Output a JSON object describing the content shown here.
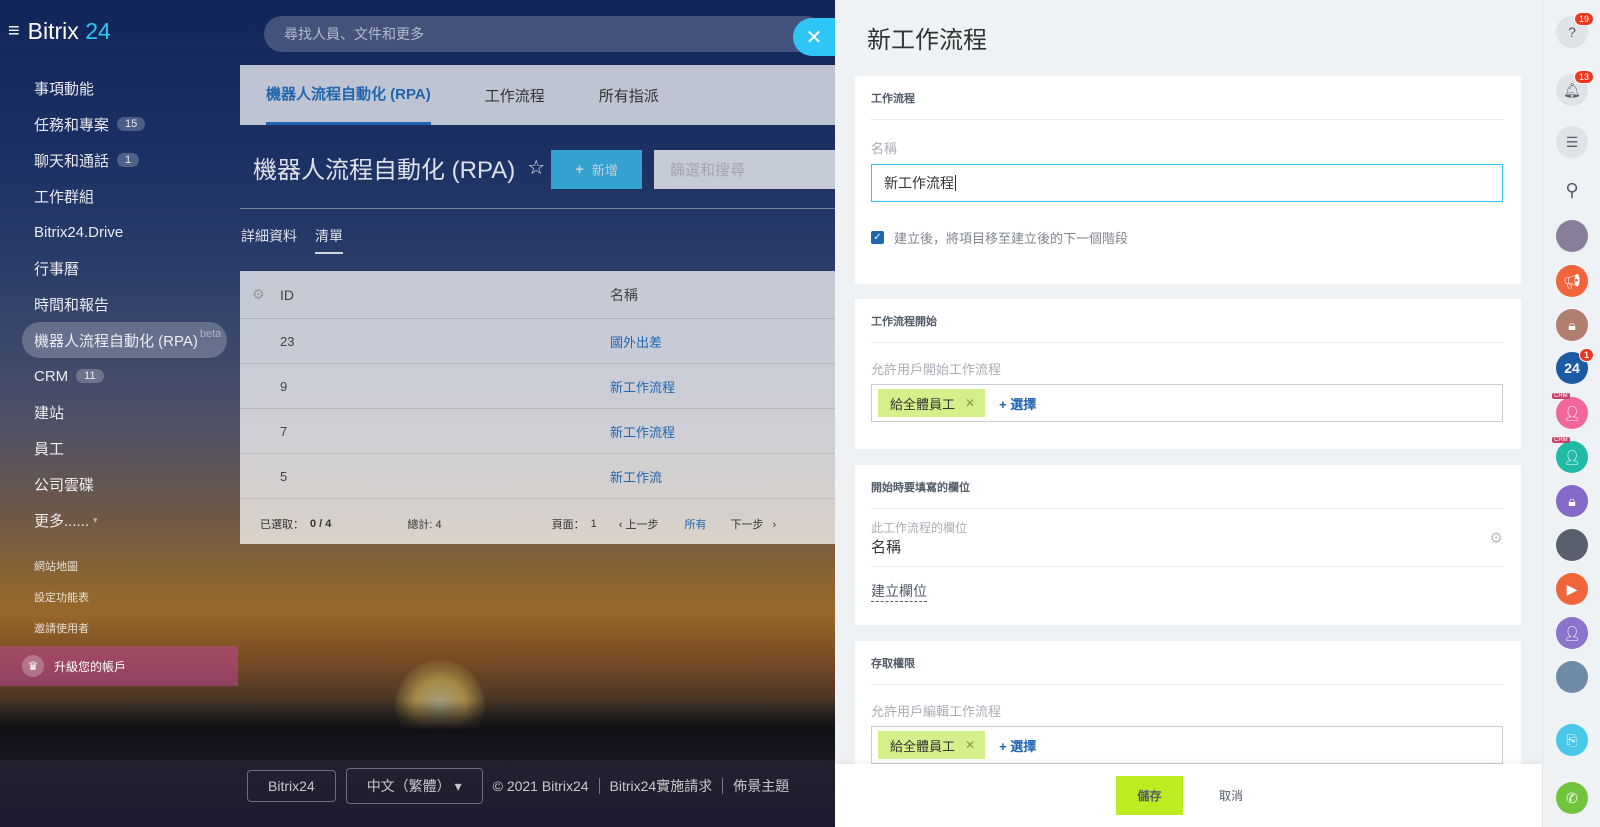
{
  "brand": {
    "name": "Bitrix",
    "num": "24"
  },
  "menu": {
    "items": [
      {
        "label": "事項動能",
        "count": ""
      },
      {
        "label": "任務和專案",
        "count": "15"
      },
      {
        "label": "聊天和通話",
        "count": "1"
      },
      {
        "label": "工作群組",
        "count": ""
      },
      {
        "label": "Bitrix24.Drive",
        "count": ""
      },
      {
        "label": "行事曆",
        "count": ""
      },
      {
        "label": "時間和報告",
        "count": ""
      },
      {
        "label": "機器人流程自動化 (RPA)",
        "count": "",
        "beta": "beta"
      },
      {
        "label": "CRM",
        "count": "11"
      },
      {
        "label": "建站",
        "count": ""
      },
      {
        "label": "員工",
        "count": ""
      },
      {
        "label": "公司雲碟",
        "count": ""
      },
      {
        "label": "更多...... ",
        "count": ""
      }
    ],
    "small_links": [
      "網站地圖",
      "設定功能表",
      "邀請使用者"
    ],
    "upgrade": "升級您的帳戶"
  },
  "search": {
    "placeholder": "尋找人員、文件和更多"
  },
  "rpa": {
    "tabs": [
      "機器人流程自動化 (RPA)",
      "工作流程",
      "所有指派"
    ],
    "title": "機器人流程自動化 (RPA)",
    "add_label": "新增",
    "filter_placeholder": "篩選和搜尋",
    "subtabs": [
      "詳細資料",
      "清單"
    ],
    "grid": {
      "col_id": "ID",
      "col_name": "名稱",
      "rows": [
        {
          "id": "23",
          "name": "國外出差"
        },
        {
          "id": "9",
          "name": "新工作流程"
        },
        {
          "id": "7",
          "name": "新工作流程"
        },
        {
          "id": "5",
          "name": "新工作流"
        }
      ],
      "footer": {
        "selected_label": "已選取：",
        "selected_value": "0 / 4",
        "total_label": "總計: 4",
        "page_label": "頁面：",
        "page_value": "1",
        "prev": "上一步",
        "all": "所有",
        "next": "下一步"
      }
    }
  },
  "bottom": {
    "logo": "Bitrix24",
    "lang": "中文（繁體）",
    "copyright": "© 2021 Bitrix24",
    "impl": "Bitrix24實施請求",
    "theme": "佈景主題"
  },
  "slider": {
    "title": "新工作流程",
    "s1": {
      "header": "工作流程",
      "name_label": "名稱",
      "name_value": "新工作流程",
      "checkbox_label": "建立後，將項目移至建立後的下一個階段"
    },
    "s2": {
      "header": "工作流程開始",
      "label": "允許用戶開始工作流程",
      "tag": "給全體員工",
      "select": "+ 選擇"
    },
    "s3": {
      "header": "開始時要填寫的欄位",
      "field_sub": "此工作流程的欄位",
      "field_value": "名稱",
      "create_link": "建立欄位"
    },
    "s4": {
      "header": "存取權限",
      "label": "允許用戶編輯工作流程",
      "tag": "給全體員工",
      "select": "+ 選擇"
    },
    "save": "儲存",
    "cancel": "取消"
  },
  "rightbar": {
    "help_badge": "19",
    "notify_badge": "13",
    "b24_badge": "1",
    "b24_label": "24",
    "crm_tag": "CRM"
  }
}
